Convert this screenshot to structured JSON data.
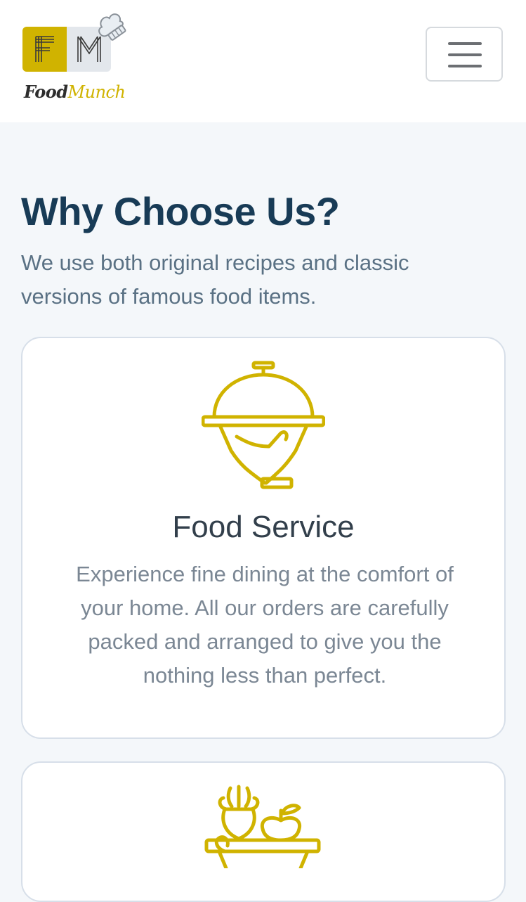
{
  "navbar": {
    "logo": {
      "mark_left_letter": "F",
      "mark_right_letter": "M",
      "wordmark_food": "Food",
      "wordmark_munch": "Munch",
      "brand_color": "#d0b300"
    },
    "menu_toggle": {
      "icon": "hamburger-icon"
    }
  },
  "why_choose_us": {
    "title": "Why Choose Us?",
    "description": "We use both original recipes and classic versions of famous food items."
  },
  "cards": [
    {
      "icon": "food-service-cloche-icon",
      "title": "Food Service",
      "text": "Experience fine dining at the comfort of your home. All our orders are carefully packed and arranged to give you the nothing less than perfect."
    },
    {
      "icon": "fresh-produce-basket-icon"
    }
  ],
  "colors": {
    "accent": "#d0b300",
    "heading": "#183b56",
    "body_text": "#5a7184",
    "background": "#f4f7fa"
  }
}
